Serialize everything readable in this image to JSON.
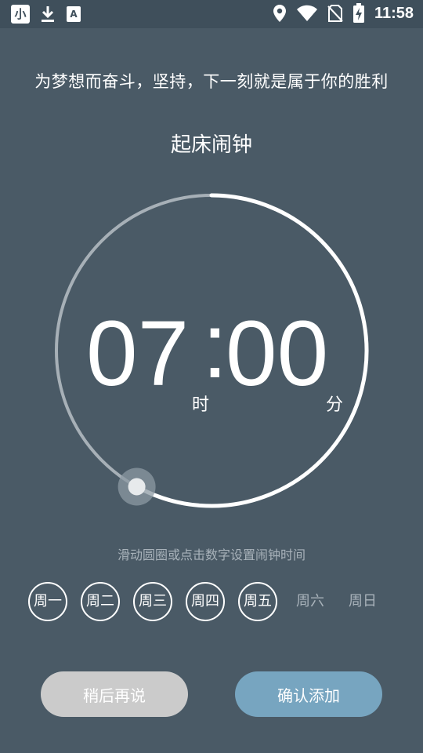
{
  "status_bar": {
    "app_icon_text": "小",
    "time": "11:58",
    "icons": [
      "download-icon",
      "a-box-icon",
      "location-icon",
      "wifi-icon",
      "no-sim-icon",
      "battery-charging-icon"
    ]
  },
  "motto": "为梦想而奋斗，坚持，下一刻就是属于你的胜利",
  "title": "起床闹钟",
  "clock": {
    "hours": "07",
    "colon": ":",
    "minutes": "00",
    "hour_unit": "时",
    "minute_unit": "分",
    "progress_fraction": 0.58
  },
  "hint": "滑动圆圈或点击数字设置闹钟时间",
  "days": [
    {
      "label": "周一",
      "selected": true
    },
    {
      "label": "周二",
      "selected": true
    },
    {
      "label": "周三",
      "selected": true
    },
    {
      "label": "周四",
      "selected": true
    },
    {
      "label": "周五",
      "selected": true
    },
    {
      "label": "周六",
      "selected": false
    },
    {
      "label": "周日",
      "selected": false
    }
  ],
  "buttons": {
    "later": "稍后再说",
    "confirm": "确认添加"
  },
  "colors": {
    "background": "#4a5a66",
    "status_bar": "#3f4f5b",
    "ring_active": "#ffffff",
    "ring_inactive": "#a7b0b7",
    "later_button": "#cbcbcb",
    "confirm_button": "#77a5c0",
    "muted_text": "#a8b2ba"
  }
}
